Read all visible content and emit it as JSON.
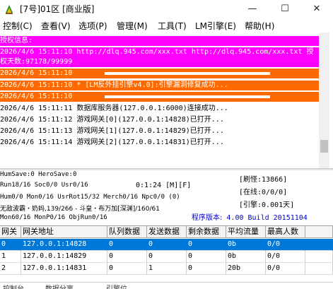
{
  "window": {
    "title": "[7号]01区 [商业版]",
    "minimize": "—",
    "maximize": "☐",
    "close": "✕"
  },
  "menu": [
    "控制(C)",
    "查看(V)",
    "选项(P)",
    "管理(M)",
    "工具(T)",
    "LM引擎(E)",
    "帮助(H)"
  ],
  "log": [
    {
      "style": "magenta",
      "text": "授权信息:"
    },
    {
      "style": "magenta",
      "text": "2026/4/6 15:11:10 http://dlq.945.com/xxx.txt http://dlq.945.com/xxx.txt 授"
    },
    {
      "style": "magenta",
      "text": "权天数:97178/99999"
    },
    {
      "style": "orange",
      "text": "2026/4/6 15:11:10 "
    },
    {
      "style": "orange",
      "text": "2026/4/6 15:11:10 * [LM反外挂引擎v4.0]:引擎漏洞修复成功..."
    },
    {
      "style": "orange",
      "text": "2026/4/6 15:11:10 "
    },
    {
      "style": "plain",
      "text": "2026/4/6 15:11:11 数据库服务器(127.0.0.1:6000)连接成功..."
    },
    {
      "style": "plain",
      "text": "2026/4/6 15:11:12 游戏网关[0](127.0.0.1:14828)已打开..."
    },
    {
      "style": "plain",
      "text": "2026/4/6 15:11:13 游戏网关[1](127.0.0.1:14829)已打开..."
    },
    {
      "style": "plain",
      "text": "2026/4/6 15:11:14 游戏网关[2](127.0.0.1:14831)已打开..."
    }
  ],
  "status": {
    "line1": "HumSave:0 HeroSave:0",
    "line2": "Run18/16 Soc0/0 Usr0/16",
    "time": "0:1:24 [M][F]",
    "line3": "Hum0/0 Mon0/16 UsrRot15/32 Merch0/16 Npc0/0 (0)",
    "line4": "无敌波霸・奶妈,139/266 - 斗皇・布万加[深渊]/160/61",
    "line5": "Mon60/16 MonP0/16 ObjRun0/16",
    "spin": "[刷怪:13866]",
    "online": "[在线:0/0/0]",
    "engine": "[引擎:0.001天]",
    "version_label": "程序版本:",
    "version_value": "4.00 Build 20151104"
  },
  "gateways": {
    "headers": [
      "网关",
      "网关地址",
      "队列数据",
      "发送数据",
      "剩余数据",
      "平均流量",
      "最高人数"
    ],
    "rows": [
      [
        "0",
        "127.0.0.1:14828",
        "0",
        "0",
        "0",
        "0b",
        "0/0"
      ],
      [
        "1",
        "127.0.0.1:14829",
        "0",
        "0",
        "0",
        "0b",
        "0/0"
      ],
      [
        "2",
        "127.0.0.1:14831",
        "0",
        "1",
        "0",
        "20b",
        "0/0"
      ]
    ]
  },
  "bottom": [
    "控制台",
    "数据分离",
    "引擎位"
  ],
  "colors": {
    "magenta": "#ff00ff",
    "orange": "#ff6a00",
    "selection": "#0078d7",
    "version": "#0000cc"
  }
}
